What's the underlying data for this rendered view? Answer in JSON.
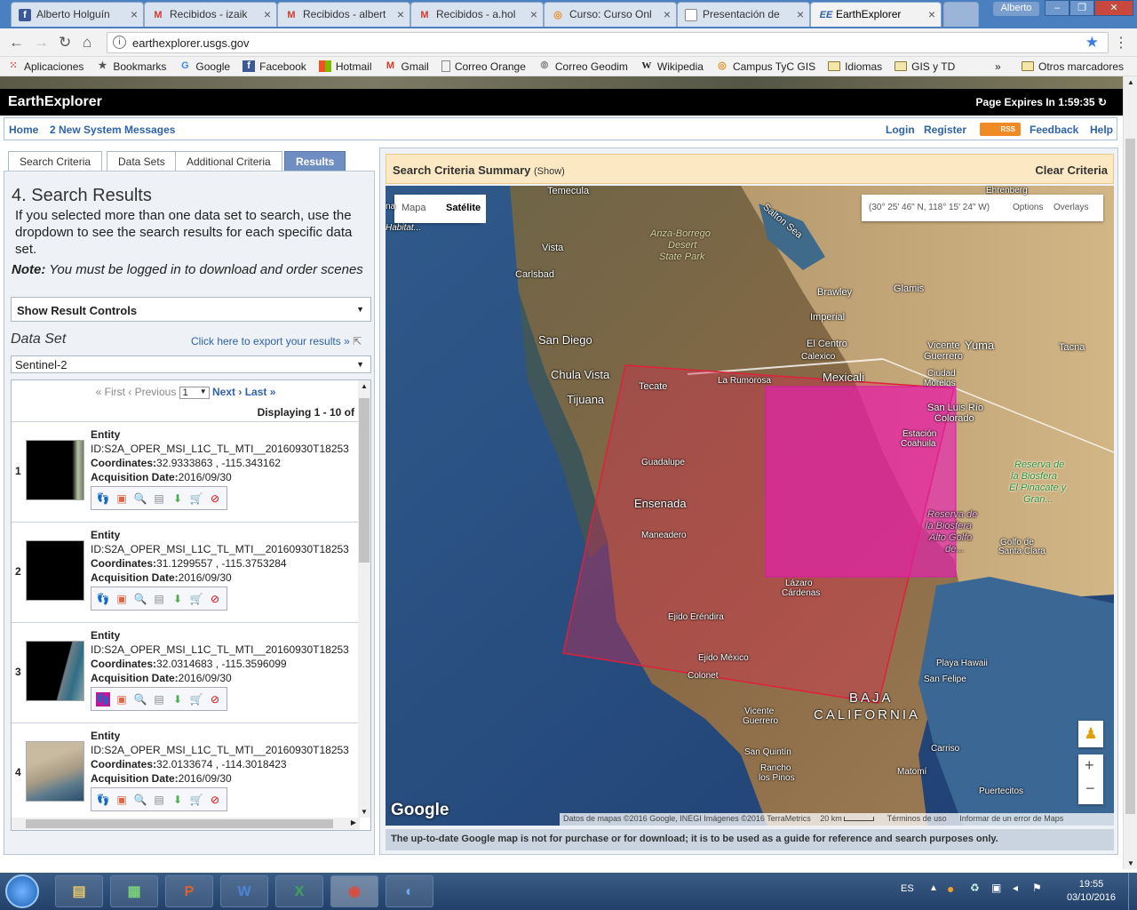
{
  "browser": {
    "tabs": [
      {
        "label": "Alberto Holguín",
        "icon": "facebook-icon"
      },
      {
        "label": "Recibidos - izaik",
        "icon": "gmail-icon"
      },
      {
        "label": "Recibidos - albert",
        "icon": "gmail-icon"
      },
      {
        "label": "Recibidos - a.hol",
        "icon": "gmail-icon"
      },
      {
        "label": "Curso: Curso Onl",
        "icon": "moodle-icon"
      },
      {
        "label": "Presentación de",
        "icon": "document-icon"
      },
      {
        "label": "EarthExplorer",
        "icon": "earthexplorer-icon"
      }
    ],
    "user": "Alberto",
    "url": "earthexplorer.usgs.gov",
    "bookmarks": [
      {
        "label": "Aplicaciones",
        "icon": "apps-icon"
      },
      {
        "label": "Bookmarks",
        "icon": "star-icon"
      },
      {
        "label": "Google",
        "icon": "google-icon"
      },
      {
        "label": "Facebook",
        "icon": "facebook-icon"
      },
      {
        "label": "Hotmail",
        "icon": "windows-icon"
      },
      {
        "label": "Gmail",
        "icon": "gmail-icon"
      },
      {
        "label": "Correo Orange",
        "icon": "document-icon"
      },
      {
        "label": "Correo Geodim",
        "icon": "document-icon"
      },
      {
        "label": "Wikipedia",
        "icon": "wikipedia-icon"
      },
      {
        "label": "Campus TyC GIS",
        "icon": "moodle-icon"
      },
      {
        "label": "Idiomas",
        "icon": "folder-icon"
      },
      {
        "label": "GIS y TD",
        "icon": "folder-icon"
      }
    ],
    "more": "»",
    "other_bookmarks": "Otros marcadores"
  },
  "header": {
    "title": "EarthExplorer",
    "expires": "Page Expires In 1:59:35"
  },
  "nav": {
    "home": "Home",
    "messages": "2 New System Messages",
    "login": "Login",
    "register": "Register",
    "rss": "RSS",
    "feedback": "Feedback",
    "help": "Help"
  },
  "search_tabs": [
    "Search Criteria",
    "Data Sets",
    "Additional Criteria",
    "Results"
  ],
  "results": {
    "heading": "4. Search Results",
    "intro": "If you selected more than one data set to search, use the dropdown to see the search results for each specific data set.",
    "note_label": "Note:",
    "note_text": " You must be logged in to download and order scenes",
    "controls": "Show Result Controls",
    "dataset_label": "Data Set",
    "export": "Click here to export your results »",
    "dataset_value": "Sentinel-2",
    "pager": {
      "first": "« First",
      "prev": "‹ Previous",
      "page": "1",
      "next": "Next ›",
      "last": "Last »"
    },
    "displaying": "Displaying 1 - 10 of",
    "entity_label": "Entity",
    "coord_label": "Coordinates:",
    "date_label": "Acquisition Date:",
    "rows": [
      {
        "n": "1",
        "id": "ID:S2A_OPER_MSI_L1C_TL_MTI__20160930T18253",
        "coords": "32.9333863 , -115.343162",
        "date": "2016/09/30"
      },
      {
        "n": "2",
        "id": "ID:S2A_OPER_MSI_L1C_TL_MTI__20160930T18253",
        "coords": "31.1299557 , -115.3753284",
        "date": "2016/09/30"
      },
      {
        "n": "3",
        "id": "ID:S2A_OPER_MSI_L1C_TL_MTI__20160930T18253",
        "coords": "32.0314683 , -115.3596099",
        "date": "2016/09/30"
      },
      {
        "n": "4",
        "id": "ID:S2A_OPER_MSI_L1C_TL_MTI__20160930T18253",
        "coords": "32.0133674 , -114.3018423",
        "date": "2016/09/30"
      }
    ]
  },
  "map": {
    "summary_title": "Search Criteria Summary",
    "summary_show": "(Show)",
    "clear": "Clear Criteria",
    "type_map": "Mapa",
    "type_sat": "Satélite",
    "coords": "(30° 25' 46\" N, 118° 15' 24\" W)",
    "options": "Options",
    "overlays": "Overlays",
    "google": "Google",
    "attribution": "Datos de mapas ©2016 Google, INEGI Imágenes ©2016 TerraMetrics",
    "scale": "20 km",
    "terms": "Términos de uso",
    "report": "Informar de un error de Maps",
    "note": "The up-to-date Google map is not for purchase or for download; it is to be used as a guide for reference and search purposes only.",
    "labels": [
      "Temecula",
      "Salton Sea",
      "Anza-Borrego",
      "Desert",
      "State Park",
      "Vista",
      "Carlsbad",
      "Glamis",
      "Brawley",
      "Imperial",
      "El Centro",
      "Calexico",
      "Vicente",
      "Guerrero",
      "Yuma",
      "Tacna",
      "San Diego",
      "Chula Vista",
      "Tijuana",
      "Tecate",
      "La Rumorosa",
      "Mexicali",
      "Ciudad",
      "Morelos",
      "San Luis Río",
      "Colorado",
      "Estación",
      "Coahuila",
      "Guadalupe",
      "Ensenada",
      "Maneadero",
      "Reserva de",
      "la Biosfera",
      "El Pinacate y",
      "Gran...",
      "Reserva de",
      "la Biosfera",
      "Alto Golfo",
      "de...",
      "Golfo de",
      "Santa Clara",
      "Lázaro",
      "Cárdenas",
      "Ejido Eréndira",
      "Ejido México",
      "Colonet",
      "Playa Hawaii",
      "San Felipe",
      "BAJA",
      "CALIFORNIA",
      "Vicente",
      "Guerrero",
      "San Quintín",
      "Rancho",
      "los Pinos",
      "Carriso",
      "Matomí",
      "Puertecitos",
      "na",
      "Habitat...",
      "Ehrenberg"
    ]
  },
  "taskbar": {
    "lang": "ES",
    "time": "19:55",
    "date": "03/10/2016"
  }
}
